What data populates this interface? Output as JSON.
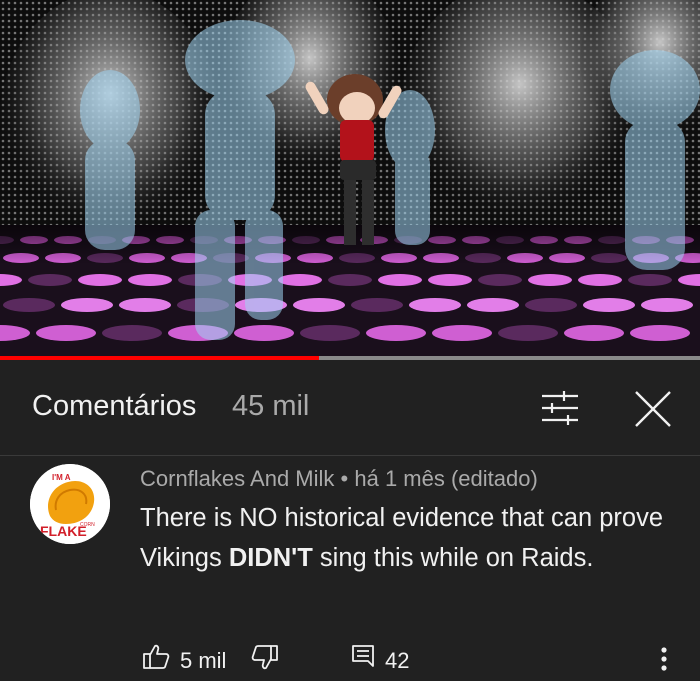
{
  "video": {
    "progress": 0.455
  },
  "comments_panel": {
    "title": "Comentários",
    "count": "45 mil",
    "filter_icon": "sliders-icon",
    "close_icon": "close-icon"
  },
  "comment": {
    "author": "Cornflakes And Milk",
    "separator": "•",
    "time": "há 1 mês (editado)",
    "text_before": "There is NO historical evidence that can prove Vikings ",
    "text_bold": "DIDN'T",
    "text_after": " sing this while on Raids.",
    "likes": "5 mil",
    "replies": "42",
    "avatar_text_top": "I'M A",
    "avatar_text_mid": "CORN",
    "avatar_text_bottom": "FLAKE"
  },
  "colors": {
    "background": "#212121",
    "text": "#f1f1f1",
    "secondary": "#aaaaaa",
    "progress": "#ff0000"
  }
}
